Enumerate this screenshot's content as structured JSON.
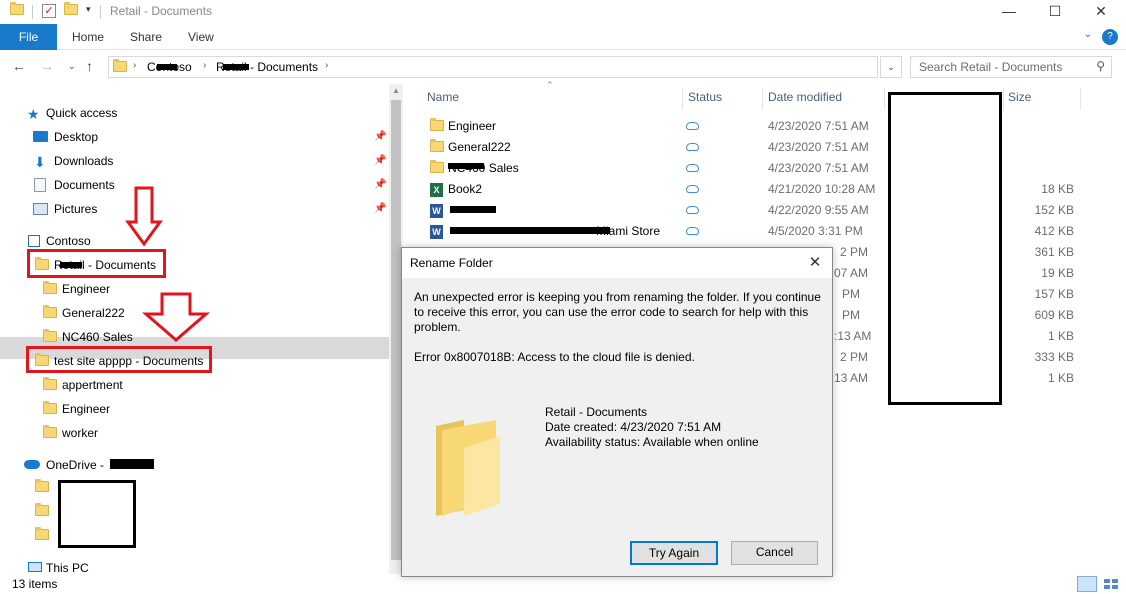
{
  "window": {
    "title": "Retail - Documents",
    "minimize": "—",
    "maximize": "☐",
    "close": "✕"
  },
  "ribbon": {
    "tabs": [
      "File",
      "Home",
      "Share",
      "View"
    ],
    "help": "?"
  },
  "address": {
    "crumbs": [
      "Contoso",
      "Retail - Documents"
    ],
    "search_placeholder": "Search Retail - Documents"
  },
  "nav_pane": {
    "quick_access": "Quick access",
    "quick_items": [
      "Desktop",
      "Downloads",
      "Documents",
      "Pictures"
    ],
    "contoso": "Contoso",
    "retail": "Retail - Documents",
    "retail_children": [
      "Engineer",
      "General222",
      "NC460 Sales"
    ],
    "test_site": "test site apppp - Documents",
    "test_children": [
      "appertment",
      "Engineer",
      "worker"
    ],
    "onedrive": "OneDrive -",
    "this_pc": "This PC"
  },
  "columns": [
    "Name",
    "Status",
    "Date modified",
    "Size"
  ],
  "files": [
    {
      "name": "Engineer",
      "type": "folder",
      "date": "4/23/2020 7:51 AM",
      "size": ""
    },
    {
      "name": "General222",
      "type": "folder",
      "date": "4/23/2020 7:51 AM",
      "size": ""
    },
    {
      "name": "NC460 Sales",
      "type": "folder",
      "date": "4/23/2020 7:51 AM",
      "size": ""
    },
    {
      "name": "Book2",
      "type": "excel",
      "date": "4/21/2020 10:28 AM",
      "size": "18 KB"
    },
    {
      "name": "",
      "type": "word",
      "date": "4/22/2020 9:55 AM",
      "size": "152 KB"
    },
    {
      "name": "Miami Store",
      "type": "word",
      "date": "4/5/2020 3:31 PM",
      "size": "412 KB"
    },
    {
      "name": "",
      "type": "file",
      "date": "2 PM",
      "size": "361 KB"
    },
    {
      "name": "",
      "type": "file",
      "date": "07 AM",
      "size": "19 KB"
    },
    {
      "name": "",
      "type": "file",
      "date": "PM",
      "size": "157 KB"
    },
    {
      "name": "",
      "type": "file",
      "date": "PM",
      "size": "609 KB"
    },
    {
      "name": "",
      "type": "file",
      "date": ":13 AM",
      "size": "1 KB"
    },
    {
      "name": "",
      "type": "file",
      "date": "2 PM",
      "size": "333 KB"
    },
    {
      "name": "",
      "type": "file",
      "date": "13 AM",
      "size": "1 KB"
    }
  ],
  "status_bar": {
    "items": "13 items"
  },
  "dialog": {
    "title": "Rename Folder",
    "message": "An unexpected error is keeping you from renaming the folder. If you continue to receive this error, you can use the error code to search for help with this problem.",
    "error": "Error 0x8007018B: Access to the cloud file is denied.",
    "item_name": "Retail - Documents",
    "date_created": "Date created: 4/23/2020 7:51 AM",
    "availability": "Availability status: Available when online",
    "try_again": "Try Again",
    "cancel": "Cancel"
  },
  "colors": {
    "accent": "#1979ca",
    "annotation_red": "#e3141c",
    "folder": "#f8d775"
  }
}
